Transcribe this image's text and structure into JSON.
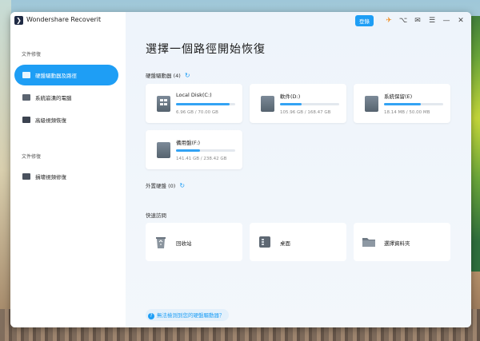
{
  "app": {
    "title": "Wondershare Recoverit",
    "logo": "❯"
  },
  "sidebar": {
    "section1": "文件修復",
    "items": [
      {
        "label": "硬盤驅動器及路徑",
        "icon": "drive-icon",
        "active": true
      },
      {
        "label": "系統崩潰的電腦",
        "icon": "monitor-icon"
      },
      {
        "label": "高級視頻恢復",
        "icon": "video-camera-icon"
      }
    ],
    "section2": "文件修復",
    "items2": [
      {
        "label": "損壞視頻修復",
        "icon": "video-repair-icon"
      }
    ]
  },
  "toolbar": {
    "login": "登錄",
    "icons": [
      "cart-icon",
      "headset-icon",
      "mail-icon",
      "menu-icon",
      "minimize-icon",
      "close-icon"
    ],
    "glyphs": {
      "cart": "✈",
      "headset": "⌥",
      "mail": "✉",
      "menu": "☰",
      "minimize": "—",
      "close": "✕"
    }
  },
  "main": {
    "title": "選擇一個路徑開始恢復",
    "hard_drives_label": "硬盤驅動器",
    "hard_drives_count": "(4)",
    "refresh": "↻",
    "drives": [
      {
        "name": "Local Disk(C:)",
        "size": "6.96 GB / 70.00 GB",
        "fill_fraction": 0.9,
        "windows": true
      },
      {
        "name": "軟件(D:)",
        "size": "105.96 GB / 168.47 GB",
        "fill_fraction": 0.37
      },
      {
        "name": "系統保留(E)",
        "size": "18.14 MB / 50.00 MB",
        "fill_fraction": 0.62
      },
      {
        "name": "備用盤(F:)",
        "size": "141.41 GB / 238.42 GB",
        "fill_fraction": 0.41
      }
    ],
    "external_label": "外置硬盤",
    "external_count": "(0)",
    "quick_access_label": "快速訪問",
    "quick_access": [
      {
        "label": "回收站",
        "icon": "recycle-bin-icon"
      },
      {
        "label": "桌面",
        "icon": "desktop-icon"
      },
      {
        "label": "選擇資料夾",
        "icon": "folder-icon"
      }
    ],
    "help_link": "無法檢測到您的硬盤驅動器？",
    "help_icon": "?"
  }
}
